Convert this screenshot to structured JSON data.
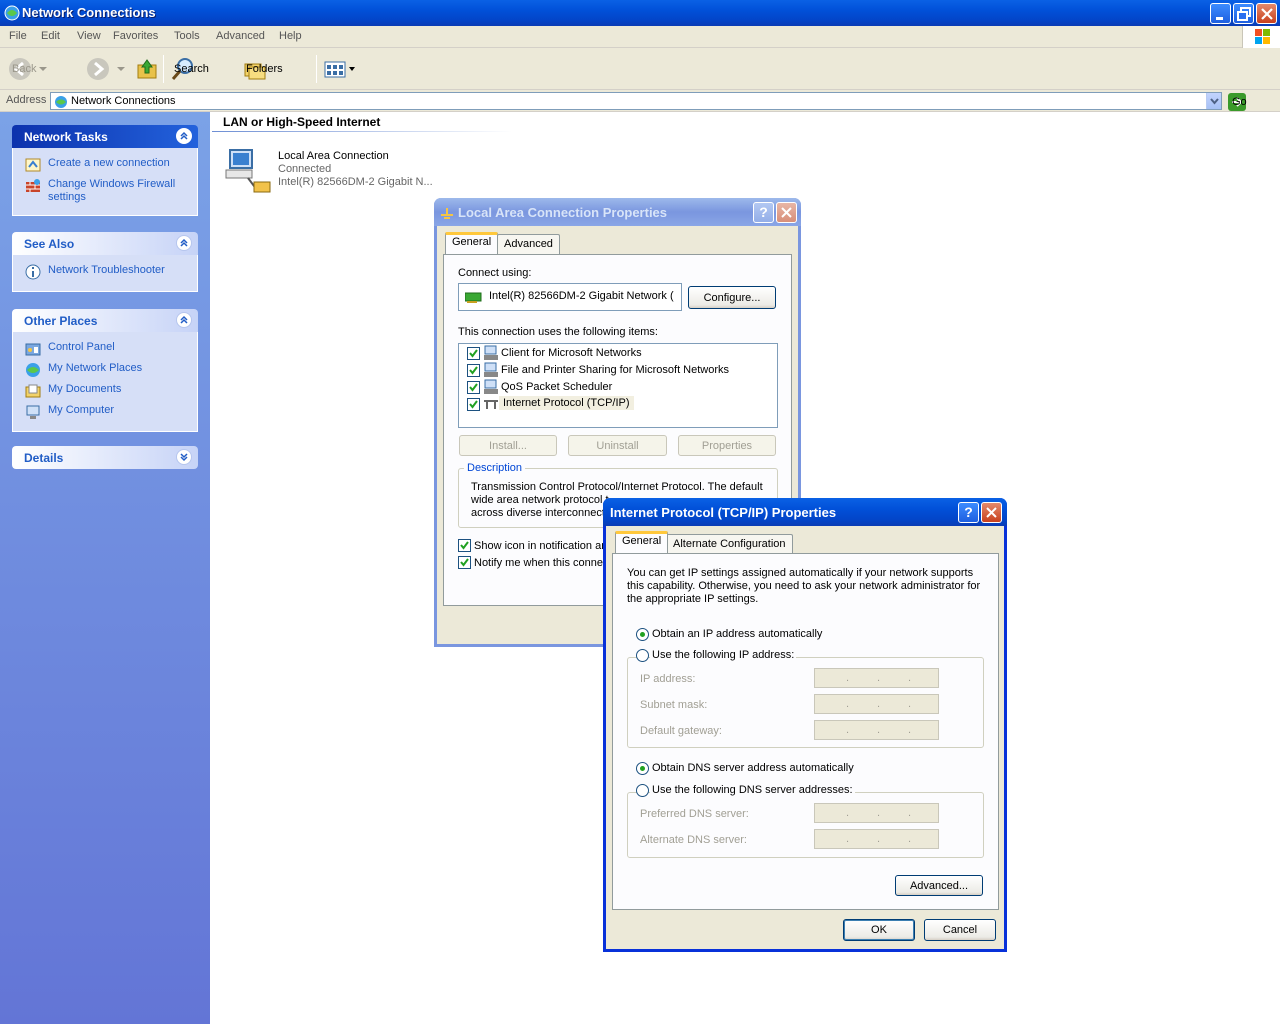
{
  "window": {
    "title": "Network Connections"
  },
  "menu": [
    "File",
    "Edit",
    "View",
    "Favorites",
    "Tools",
    "Advanced",
    "Help"
  ],
  "toolbar": {
    "back": "Back",
    "search": "Search",
    "folders": "Folders"
  },
  "address": {
    "label": "Address",
    "value": "Network Connections",
    "go": "Go"
  },
  "taskpane": {
    "network_tasks": {
      "title": "Network Tasks",
      "items": [
        "Create a new connection",
        "Change Windows Firewall settings"
      ]
    },
    "see_also": {
      "title": "See Also",
      "items": [
        "Network Troubleshooter"
      ]
    },
    "other_places": {
      "title": "Other Places",
      "items": [
        "Control Panel",
        "My Network Places",
        "My Documents",
        "My Computer"
      ]
    },
    "details": {
      "title": "Details"
    }
  },
  "content": {
    "group_title": "LAN or High-Speed Internet",
    "connection": {
      "name": "Local Area Connection",
      "status": "Connected",
      "device": "Intel(R) 82566DM-2 Gigabit N..."
    }
  },
  "lac_dialog": {
    "title": "Local Area Connection Properties",
    "tabs": [
      "General",
      "Advanced"
    ],
    "connect_using_label": "Connect using:",
    "adapter": "Intel(R) 82566DM-2 Gigabit Network (",
    "configure": "Configure...",
    "items_label": "This connection uses the following items:",
    "items": [
      "Client for Microsoft Networks",
      "File and Printer Sharing for Microsoft Networks",
      "QoS Packet Scheduler",
      "Internet Protocol (TCP/IP)"
    ],
    "install": "Install...",
    "uninstall": "Uninstall",
    "properties": "Properties",
    "description_label": "Description",
    "description_l1": "Transmission Control Protocol/Internet Protocol. The default",
    "description_l2": "wide area network protocol t",
    "description_l3": "across diverse interconnect",
    "show_icon": "Show icon in notification ar",
    "notify": "Notify me when this connect"
  },
  "tcp_dialog": {
    "title": "Internet Protocol (TCP/IP) Properties",
    "tabs": [
      "General",
      "Alternate Configuration"
    ],
    "intro_l1": "You can get IP settings assigned automatically if your network supports",
    "intro_l2": "this capability. Otherwise, you need to ask your network administrator for",
    "intro_l3": "the appropriate IP settings.",
    "obtain_ip": "Obtain an IP address automatically",
    "use_ip": "Use the following IP address:",
    "ip_address": "IP address:",
    "subnet_mask": "Subnet mask:",
    "default_gateway": "Default gateway:",
    "obtain_dns": "Obtain DNS server address automatically",
    "use_dns": "Use the following DNS server addresses:",
    "preferred_dns": "Preferred DNS server:",
    "alternate_dns": "Alternate DNS server:",
    "advanced": "Advanced...",
    "ok": "OK",
    "cancel": "Cancel"
  },
  "colors": {
    "titlebar": "#0150d8",
    "taskpane": "#7ba2e7",
    "link": "#215dc6",
    "dialog_bg": "#ece9d8"
  }
}
